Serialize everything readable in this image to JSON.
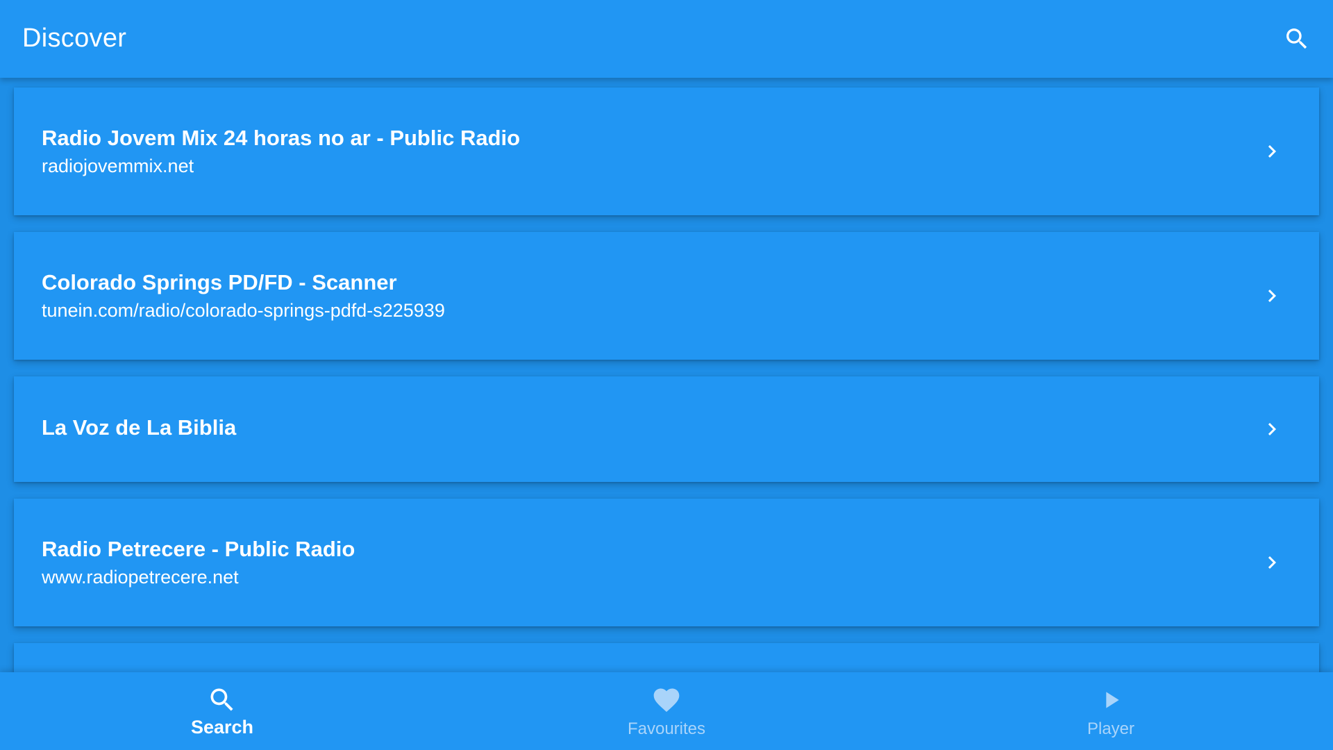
{
  "appbar": {
    "title": "Discover",
    "search_icon": "search-icon"
  },
  "stations": [
    {
      "title": "Radio Jovem Mix 24 horas no ar - Public Radio",
      "subtitle": "radiojovemmix.net"
    },
    {
      "title": "Colorado Springs PD/FD - Scanner",
      "subtitle": "tunein.com/radio/colorado-springs-pdfd-s225939"
    },
    {
      "title": "La Voz de La Biblia",
      "subtitle": ""
    },
    {
      "title": "Radio Petrecere - Public Radio",
      "subtitle": "www.radiopetrecere.net"
    }
  ],
  "bottom_nav": {
    "items": [
      {
        "label": "Search",
        "icon": "search-icon",
        "active": true
      },
      {
        "label": "Favourites",
        "icon": "heart-icon",
        "active": false
      },
      {
        "label": "Player",
        "icon": "play-icon",
        "active": false
      }
    ]
  },
  "colors": {
    "primary": "#2196f3",
    "background": "#1e8ee6",
    "text": "#ffffff",
    "inactive_nav": "#a9d4fa"
  }
}
